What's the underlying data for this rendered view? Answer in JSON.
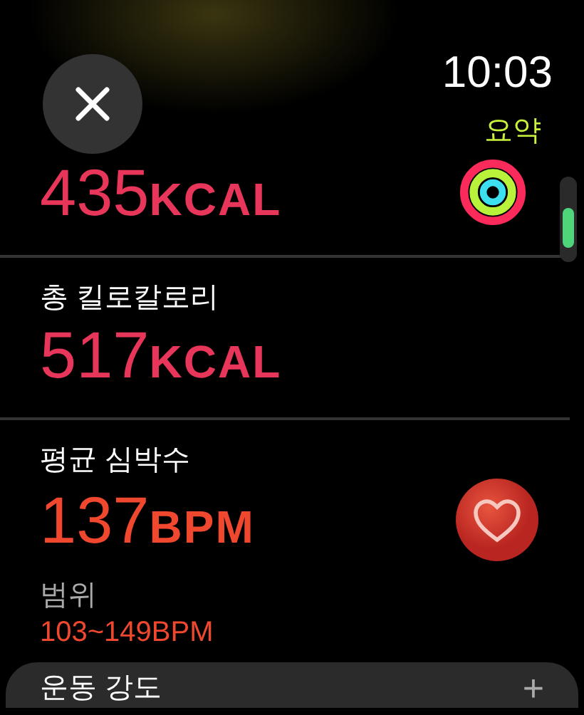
{
  "close_button": {
    "selected": false
  },
  "time": "10:03",
  "summary": {
    "label": "요약"
  },
  "metrics": [
    {
      "kind": "rings",
      "value": "435",
      "unit": "KCAL",
      "color": "#e8365a"
    },
    {
      "kind": "plain",
      "label": "총 킬로칼로리",
      "value": "517",
      "unit": "KCAL",
      "color": "#e8365a"
    },
    {
      "kind": "heart",
      "label": "평균 심박수",
      "value": "137",
      "unit": "BPM",
      "color": "#f0482e",
      "range": {
        "label": "범위",
        "value": "103~149BPM"
      }
    }
  ],
  "next_card": {
    "label": "운동 강도",
    "action": "+"
  }
}
